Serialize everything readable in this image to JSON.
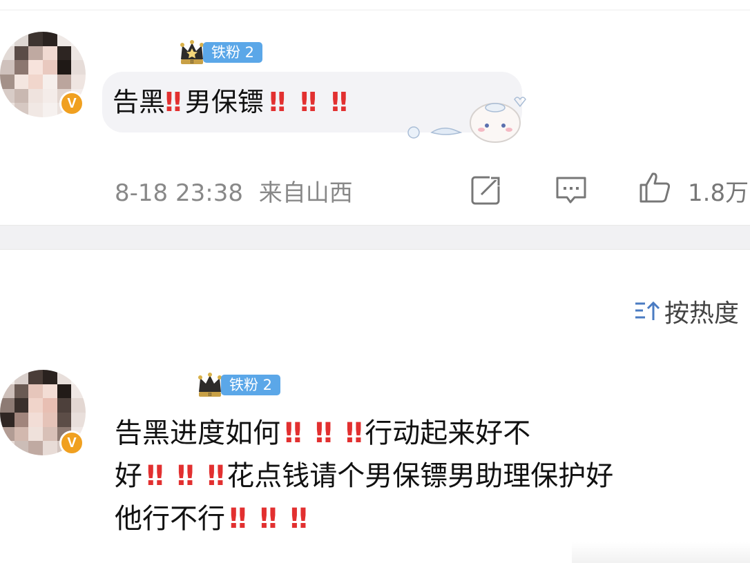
{
  "comment1": {
    "fan_badge": "铁粉 2",
    "text_parts": [
      "告黑",
      "‼",
      "男保镖",
      "‼",
      "‼",
      "‼"
    ],
    "timestamp": "8-18 23:38",
    "location": "来自山西",
    "likes": "1.8万",
    "icons": [
      "share-icon",
      "comment-icon",
      "like-icon"
    ],
    "verified_badge": "V"
  },
  "sort": {
    "label": "按热度",
    "icon": "sort-icon"
  },
  "comment2": {
    "fan_badge": "铁粉 2",
    "line1": [
      "告黑进度如何",
      "‼",
      "‼",
      "‼",
      "行动起来好不"
    ],
    "line2": [
      "好",
      "‼",
      "‼",
      "‼",
      "花点钱请个男保镖男助理保护好"
    ],
    "line3": [
      "他行不行",
      "‼",
      "‼",
      "‼"
    ],
    "verified_badge": "V"
  },
  "colors": {
    "accent_blue": "#5ba7e8",
    "exclaim_red": "#e23030",
    "verified_gold": "#f0a020",
    "meta_gray": "#888888"
  }
}
